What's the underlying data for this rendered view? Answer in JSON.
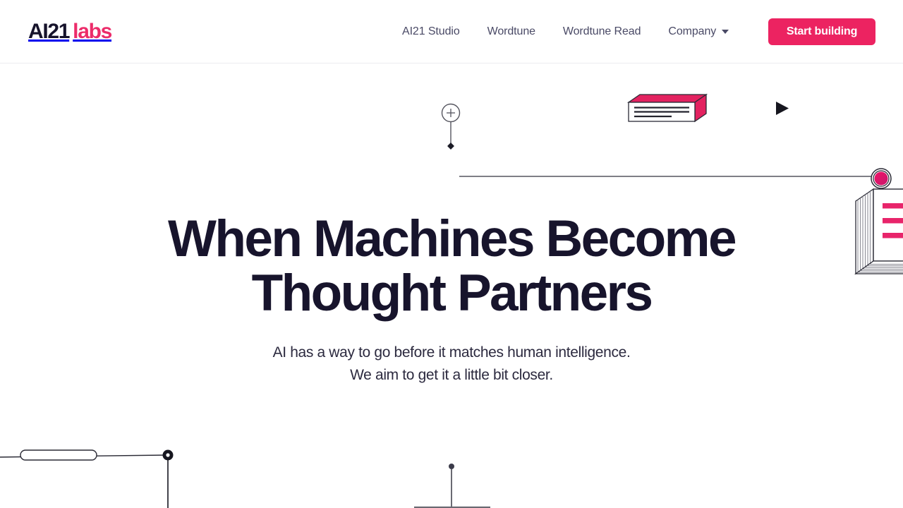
{
  "header": {
    "brand": {
      "part1": "AI21",
      "part2": "labs"
    },
    "nav_items": [
      {
        "label": "AI21 Studio",
        "has_caret": false
      },
      {
        "label": "Wordtune",
        "has_caret": false
      },
      {
        "label": "Wordtune Read",
        "has_caret": false
      },
      {
        "label": "Company",
        "has_caret": true
      }
    ],
    "cta_label": "Start building"
  },
  "hero": {
    "title_line1": "When Machines Become",
    "title_line2": "Thought Partners",
    "subtitle_line1": "AI has a way to go before it matches human intelligence.",
    "subtitle_line2": "We aim to get it a little bit closer."
  },
  "colors": {
    "brand_pink": "#ec2c6a",
    "cta_pink": "#ec2361",
    "ink": "#17142c",
    "nav_text": "#4a4a66",
    "background": "#ffffff",
    "header_border": "#ececf0",
    "decor_line": "#55555f"
  }
}
